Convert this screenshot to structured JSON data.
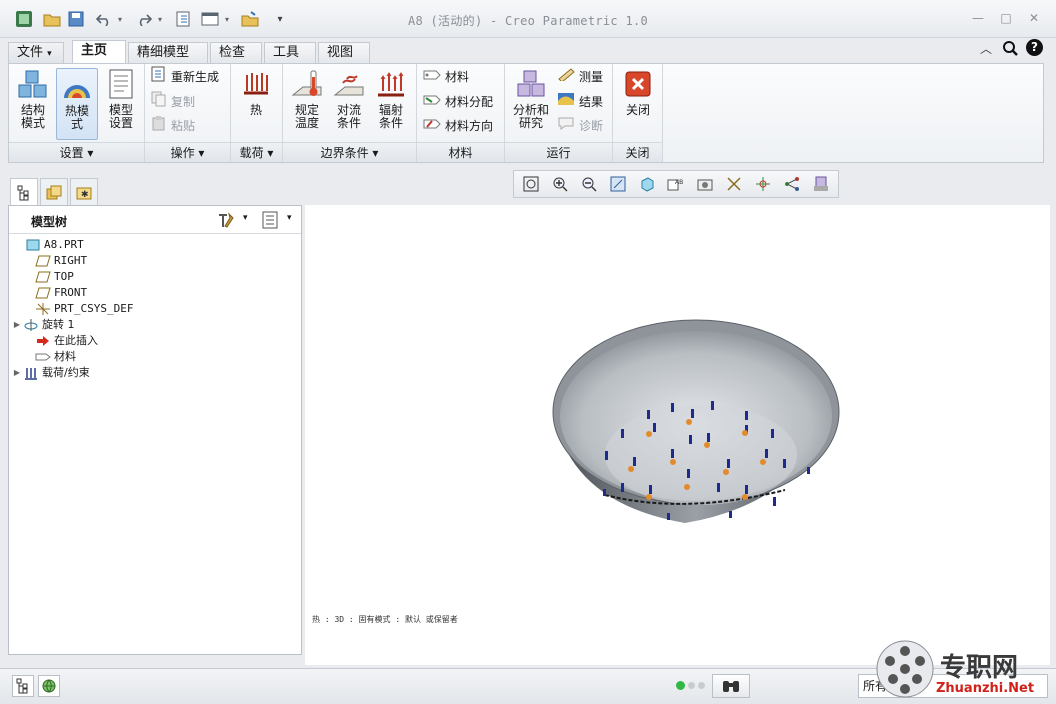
{
  "window": {
    "title": "A8 (活动的) - Creo Parametric 1.0",
    "minimize": "—",
    "maximize": "□",
    "close": "✕"
  },
  "quick_access": [
    "app-icon",
    "open-folder-icon",
    "save-icon",
    "undo-icon",
    "redo-icon",
    "regenerate-icon",
    "windows-icon",
    "close-window-icon",
    "customize-icon"
  ],
  "ribbon_tabs": [
    {
      "label": "文件",
      "active": false
    },
    {
      "label": "主页",
      "active": true
    },
    {
      "label": "精细模型",
      "active": false
    },
    {
      "label": "检查",
      "active": false
    },
    {
      "label": "工具",
      "active": false
    },
    {
      "label": "视图",
      "active": false
    }
  ],
  "file_arrow": "▾",
  "groups": {
    "setup": {
      "label": "设置 ▾",
      "buttons": [
        {
          "label": "结构\n模式"
        },
        {
          "label": "热模\n式"
        },
        {
          "label": "模型\n设置"
        }
      ]
    },
    "operations": {
      "label": "操作 ▾",
      "buttons": [
        {
          "label": "重新生成"
        },
        {
          "label": "复制"
        },
        {
          "label": "粘贴"
        }
      ]
    },
    "loads": {
      "label": "载荷 ▾",
      "buttons": [
        {
          "label": "热"
        }
      ]
    },
    "boundary": {
      "label": "边界条件 ▾",
      "buttons": [
        {
          "label": "规定\n温度"
        },
        {
          "label": "对流\n条件"
        },
        {
          "label": "辐射\n条件"
        }
      ]
    },
    "material": {
      "label": "材料",
      "buttons": [
        {
          "label": "材料"
        },
        {
          "label": "材料分配"
        },
        {
          "label": "材料方向"
        }
      ]
    },
    "run": {
      "label": "运行",
      "buttons": [
        {
          "label": "分析和\n研究"
        },
        {
          "label": "测量"
        },
        {
          "label": "结果"
        },
        {
          "label": "诊断"
        }
      ]
    },
    "close": {
      "label": "关闭",
      "buttons": [
        {
          "label": "关闭"
        }
      ]
    }
  },
  "tree": {
    "header": "模型树",
    "nodes": [
      {
        "label": "A8.PRT",
        "icon": "part-icon",
        "expand": ""
      },
      {
        "label": "RIGHT",
        "icon": "datum-plane-icon",
        "expand": ""
      },
      {
        "label": "TOP",
        "icon": "datum-plane-icon",
        "expand": ""
      },
      {
        "label": "FRONT",
        "icon": "datum-plane-icon",
        "expand": ""
      },
      {
        "label": "PRT_CSYS_DEF",
        "icon": "csys-icon",
        "expand": ""
      },
      {
        "label": "旋转 1",
        "icon": "revolve-icon",
        "expand": "▶"
      },
      {
        "label": "在此插入",
        "icon": "insert-arrow-icon",
        "expand": ""
      },
      {
        "label": "材料",
        "icon": "material-icon",
        "expand": ""
      },
      {
        "label": "载荷/约束",
        "icon": "loads-icon",
        "expand": "▶"
      }
    ]
  },
  "graphics": {
    "info": "热 : 3D : 固有模式 : 默认 或保留者"
  },
  "status": {
    "filter": "所有",
    "watermark_cn": "专职网",
    "watermark_en": "Zhuanzhi.Net"
  }
}
